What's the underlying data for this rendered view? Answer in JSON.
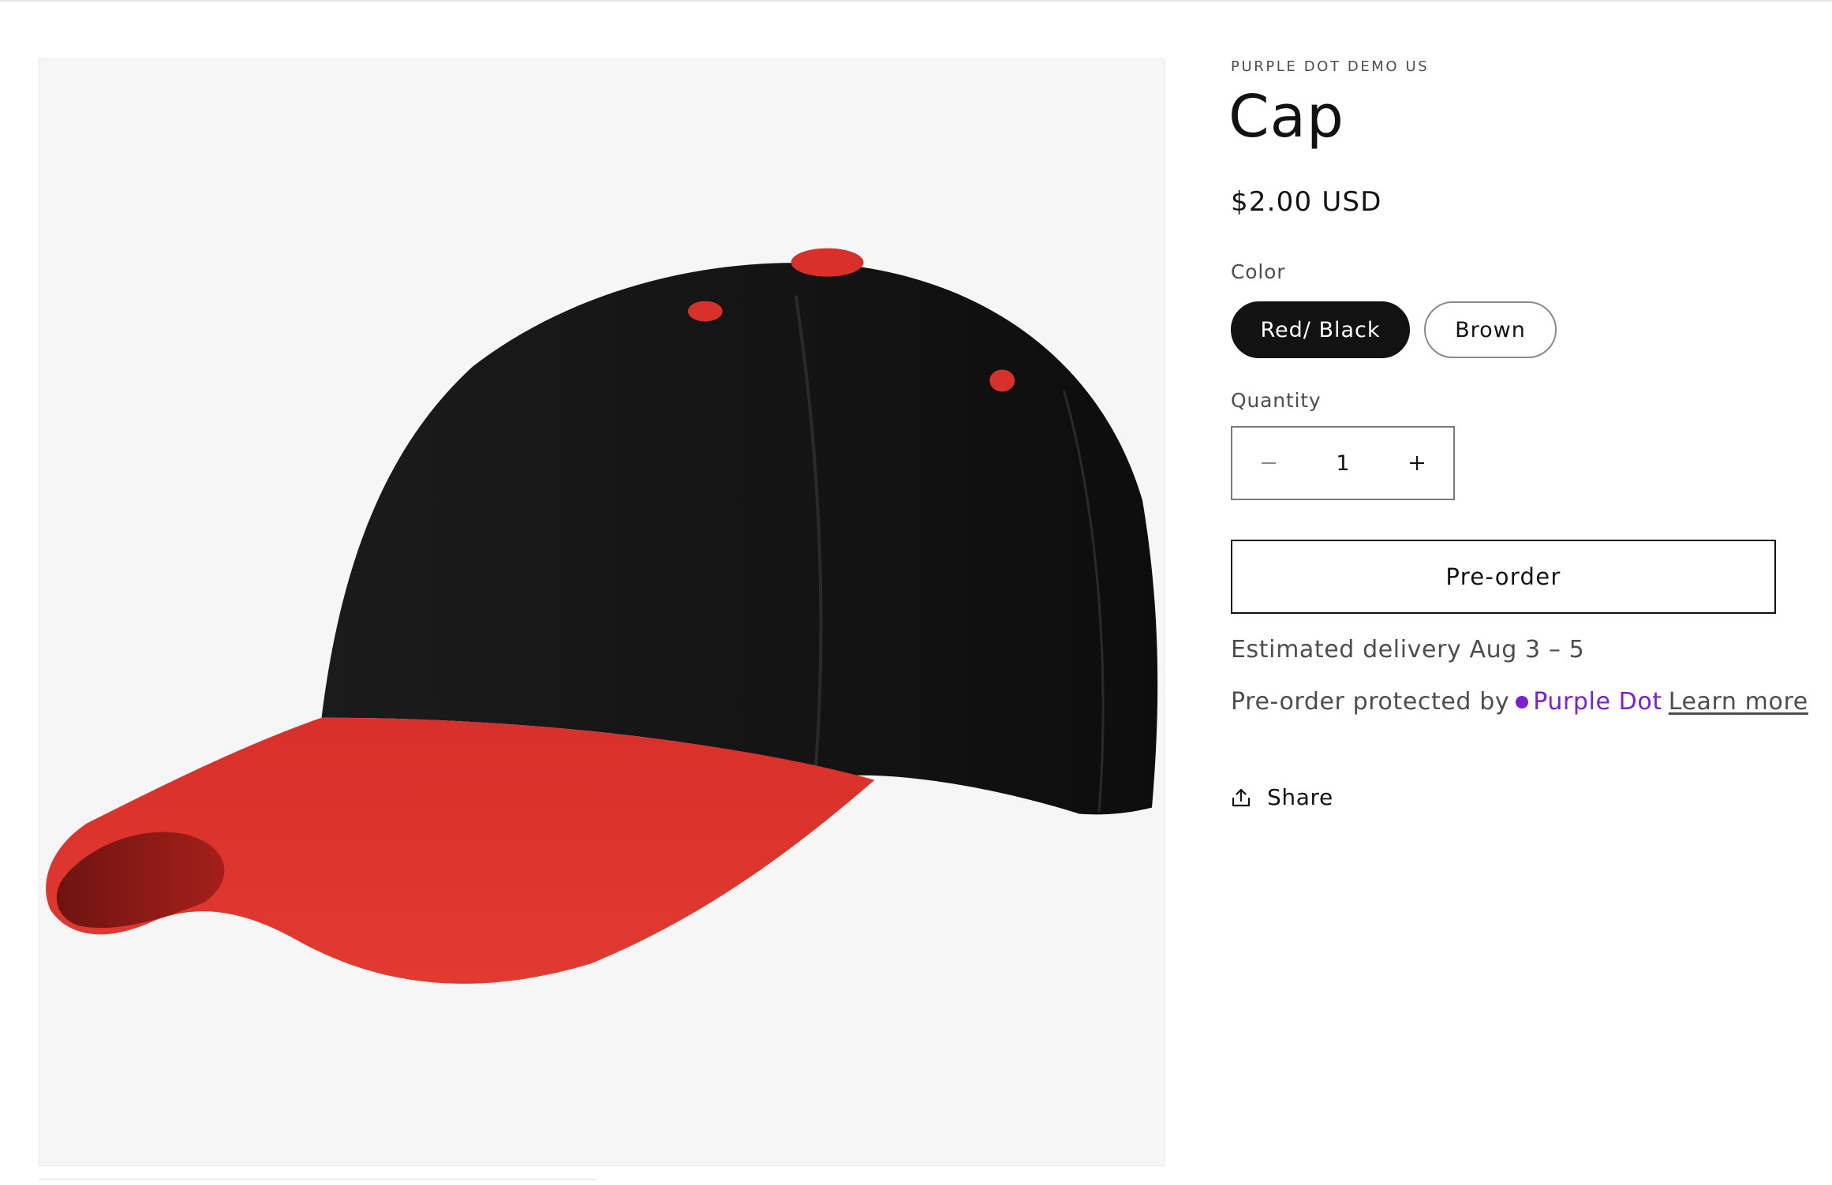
{
  "product": {
    "vendor": "PURPLE DOT DEMO US",
    "title": "Cap",
    "price": "$2.00 USD",
    "image_icon": "cap-image"
  },
  "color": {
    "label": "Color",
    "options": [
      "Red/ Black",
      "Brown"
    ],
    "selected": "Red/ Black"
  },
  "quantity": {
    "label": "Quantity",
    "value": "1",
    "decrease_icon": "minus-icon",
    "increase_icon": "plus-icon"
  },
  "preorder": {
    "button_label": "Pre-order",
    "estimated_delivery": "Estimated delivery Aug 3 – 5",
    "protected_by": "Pre-order protected by",
    "brand": "Purple Dot",
    "learn_more": "Learn more"
  },
  "share": {
    "label": "Share",
    "icon": "share-icon"
  },
  "colors": {
    "brand_purple": "#7a22d2",
    "text_primary": "#121212",
    "text_secondary": "#4d4d4d",
    "cap_crown": "#141414",
    "cap_brim": "#d8302a"
  }
}
